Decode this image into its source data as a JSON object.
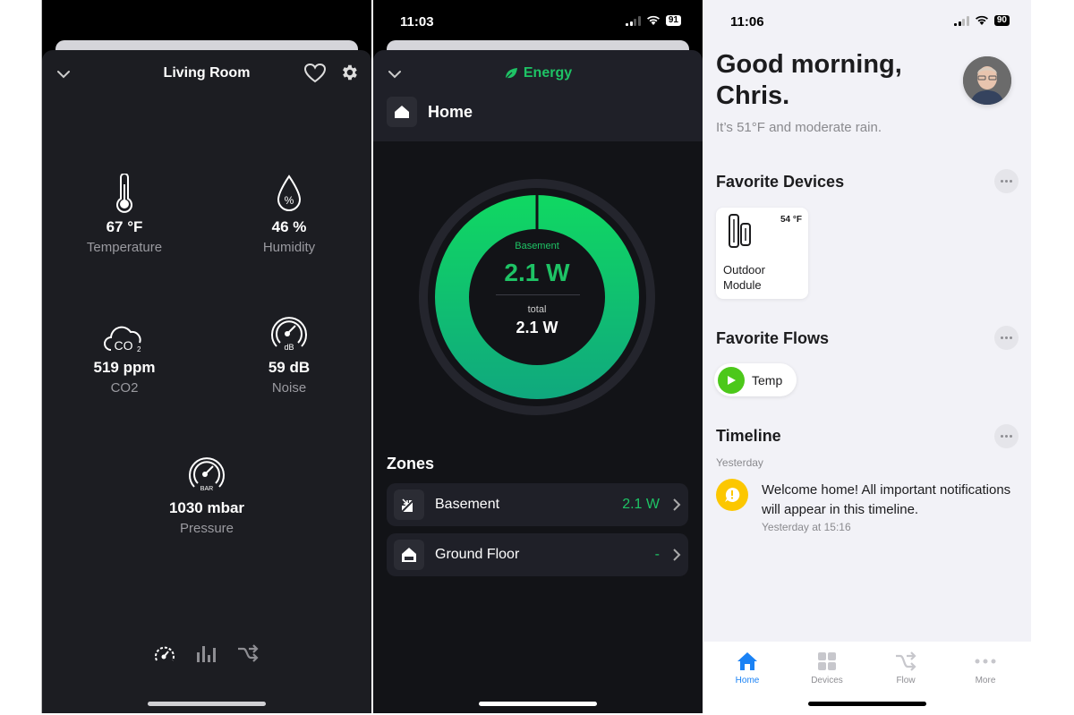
{
  "panel_living_room": {
    "title": "Living Room",
    "sensors": [
      {
        "icon": "thermometer-icon",
        "value": "67 °F",
        "label": "Temperature"
      },
      {
        "icon": "humidity-drop-icon",
        "value": "46 %",
        "label": "Humidity"
      },
      {
        "icon": "co2-cloud-icon",
        "value": "519 ppm",
        "label": "CO2"
      },
      {
        "icon": "noise-gauge-icon",
        "value": "59 dB",
        "label": "Noise"
      },
      {
        "icon": "pressure-gauge-icon",
        "value": "1030 mbar",
        "label": "Pressure"
      }
    ],
    "nav_icons": [
      "gauge-icon",
      "bar-chart-icon",
      "shuffle-flow-icon"
    ]
  },
  "panel_energy": {
    "status_time": "11:03",
    "battery": "91",
    "title": "Energy",
    "home_label": "Home",
    "donut": {
      "label": "Basement",
      "value": "2.1 W",
      "total_label": "total",
      "total_value": "2.1 W",
      "share": 1.0,
      "color_top": "#10d862",
      "color_bottom": "#10a87e"
    },
    "zones_title": "Zones",
    "zones": [
      {
        "icon": "stairs-down-icon",
        "name": "Basement",
        "value": "2.1 W"
      },
      {
        "icon": "house-floor-icon",
        "name": "Ground Floor",
        "value": "-"
      }
    ]
  },
  "panel_home": {
    "status_time": "11:06",
    "battery": "90",
    "greeting": "Good morning, Chris.",
    "weather": "It’s 51°F and moderate rain.",
    "favorite_devices_title": "Favorite Devices",
    "devices": [
      {
        "name": "Outdoor Module",
        "value": "54 °F"
      }
    ],
    "favorite_flows_title": "Favorite Flows",
    "flows": [
      {
        "name": "Temp"
      }
    ],
    "timeline_title": "Timeline",
    "timeline": [
      {
        "date": "Yesterday",
        "text": "Welcome home! All important notifications will appear in this timeline.",
        "time": "Yesterday at 15:16"
      }
    ],
    "tabs": [
      {
        "label": "Home",
        "icon": "home-icon",
        "active": true
      },
      {
        "label": "Devices",
        "icon": "grid-icon",
        "active": false
      },
      {
        "label": "Flow",
        "icon": "flow-icon",
        "active": false
      },
      {
        "label": "More",
        "icon": "more-dots-icon",
        "active": false
      }
    ],
    "accent_color": "#1a82f5"
  }
}
